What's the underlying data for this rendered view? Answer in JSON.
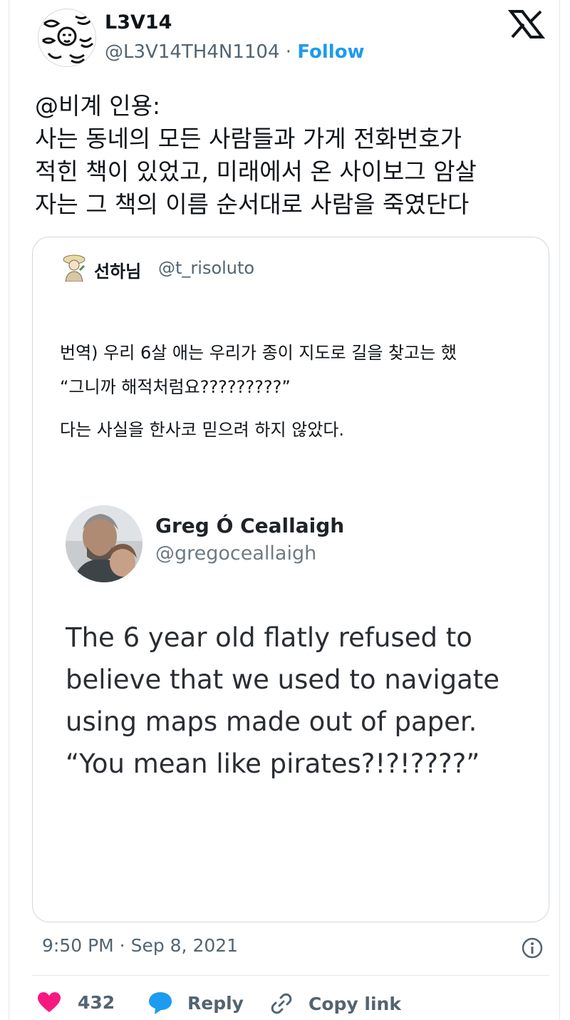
{
  "author": {
    "name": "L3V14",
    "handle": "@L3V14TH4N1104",
    "separator": "·",
    "follow_label": "Follow"
  },
  "tweet": {
    "lines": [
      "@비계 인용:",
      "사는 동네의 모든 사람들과 가게 전화번호가",
      "적힌 책이 있었고, 미래에서 온 사이보그 암살",
      "자는 그 책의 이름 순서대로 사람을 죽였단다"
    ]
  },
  "quoted": {
    "name": "선하님",
    "handle": "@t_risoluto",
    "text_lines": [
      "번역) 우리 6살 애는 우리가 종이 지도로 길을 찾고는 했",
      "다는 사실을 한사코 믿으려 하지 않았다."
    ],
    "text2": "“그니까 해적처럼요?????????”",
    "embedded": {
      "name": "Greg Ó Ceallaigh",
      "handle": "@gregoceallaigh",
      "lines": [
        "The 6 year old flatly refused to",
        "believe that we used to navigate",
        "using maps made out of paper.",
        "“You mean like pirates?!?!????”"
      ]
    }
  },
  "meta": {
    "timestamp": "9:50 PM · Sep 8, 2021"
  },
  "actions": {
    "like_count": "432",
    "reply_label": "Reply",
    "copy_link_label": "Copy link"
  },
  "colors": {
    "accent": "#1d9bf0",
    "heart": "#f91880",
    "secondary_text": "#536471"
  },
  "icons": [
    "x-logo-icon",
    "info-icon",
    "heart-icon",
    "reply-bubble-icon",
    "link-icon"
  ]
}
